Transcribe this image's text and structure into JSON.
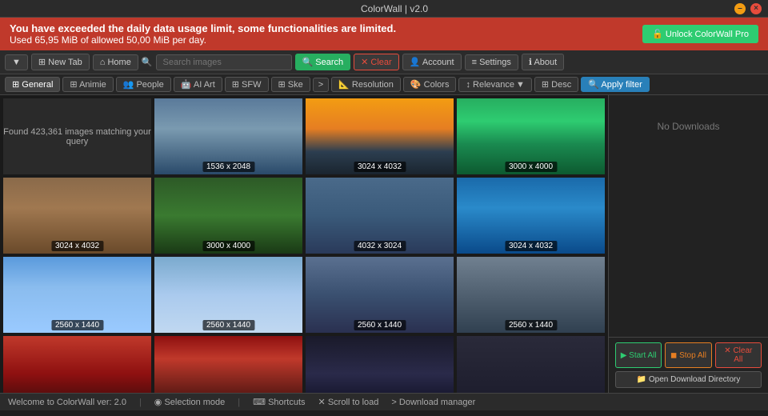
{
  "app": {
    "title": "ColorWall | v2.0",
    "close_btn": "×",
    "minimize_btn": "–"
  },
  "warning": {
    "line1": "You have exceeded the daily data usage limit, some functionalities are limited.",
    "line2": "Used 65,95 MiB of allowed 50,00 MiB per day.",
    "unlock_label": "🔓 Unlock ColorWall Pro"
  },
  "toolbar": {
    "dropdown_label": "▼",
    "new_tab_label": "⊞ New Tab",
    "home_label": "⌂ Home",
    "search_placeholder": "Search images",
    "search_btn_label": "🔍 Search",
    "clear_btn_label": "✕ Clear",
    "account_label": "👤 Account",
    "settings_label": "≡ Settings",
    "about_label": "ℹ About"
  },
  "filters": {
    "items": [
      {
        "label": "⊞ General",
        "active": true
      },
      {
        "label": "⊞ Animie",
        "active": false
      },
      {
        "label": "👥 People",
        "active": false
      },
      {
        "label": "🤖 AI Art",
        "active": false
      },
      {
        "label": "⊞ SFW",
        "active": false
      },
      {
        "label": "⊞ Ske",
        "active": false
      }
    ],
    "chevron": ">",
    "resolution_label": "📐 Resolution",
    "colors_label": "🎨 Colors",
    "relevance_label": "↕ Relevance",
    "relevance_arrow": "▼",
    "desc_label": "⊞ Desc",
    "apply_label": "🔍 Apply filter"
  },
  "grid": {
    "info_text": "Found 423,361 images matching your query",
    "images": [
      {
        "type": "waterfall",
        "dim": "1536 x 2048"
      },
      {
        "type": "sunset",
        "dim": "3024 x 4032"
      },
      {
        "type": "river",
        "dim": "3000 x 4000"
      },
      {
        "type": "canyon",
        "dim": "3024 x 4032"
      },
      {
        "type": "forest",
        "dim": "3000 x 4000"
      },
      {
        "type": "gorge",
        "dim": "4032 x 3024"
      },
      {
        "type": "ocean",
        "dim": "3024 x 4032"
      },
      {
        "type": "sky",
        "dim": "2560 x 1440"
      },
      {
        "type": "sky2",
        "dim": "2560 x 1440"
      },
      {
        "type": "castle",
        "dim": "2560 x 1440"
      },
      {
        "type": "ship",
        "dim": "2560 x 1440"
      },
      {
        "type": "spiderman",
        "dim": ""
      },
      {
        "type": "spiderman2",
        "dim": ""
      },
      {
        "type": "dark",
        "dim": ""
      }
    ]
  },
  "downloads": {
    "empty_label": "No Downloads",
    "start_label": "▶ Start All",
    "stop_label": "◼ Stop All",
    "clear_label": "✕ Clear All",
    "open_dir_label": "📁 Open Download Directory"
  },
  "statusbar": {
    "welcome": "Welcome to ColorWall ver: 2.0",
    "selection_mode": "◉ Selection mode",
    "shortcuts": "⌨ Shortcuts",
    "scroll_to_load": "✕ Scroll to load",
    "download_manager": "> Download manager"
  }
}
